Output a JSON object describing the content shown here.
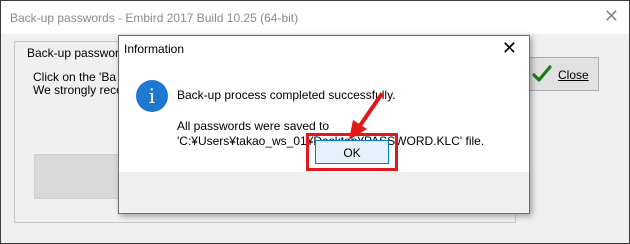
{
  "window": {
    "title": "Back-up passwords - Embird 2017 Build 10.25 (64-bit)",
    "close_glyph": "✕",
    "group_label": "Back-up passwords",
    "instruction_line1": "Click on the 'Ba",
    "instruction_line2": "We strongly reco",
    "close_button_label": "Close"
  },
  "dialog": {
    "title": "Information",
    "close_glyph": "✕",
    "icon": "information-icon",
    "icon_glyph": "i",
    "message_line1": "Back-up process completed successfully.",
    "message_line2": "All passwords were saved to",
    "message_line3": "'C:¥Users¥takao_ws_01¥Desktop¥PASSWORD.KLC' file.",
    "ok_label": "OK"
  },
  "annotation": {
    "highlight_color": "#e3161a"
  }
}
